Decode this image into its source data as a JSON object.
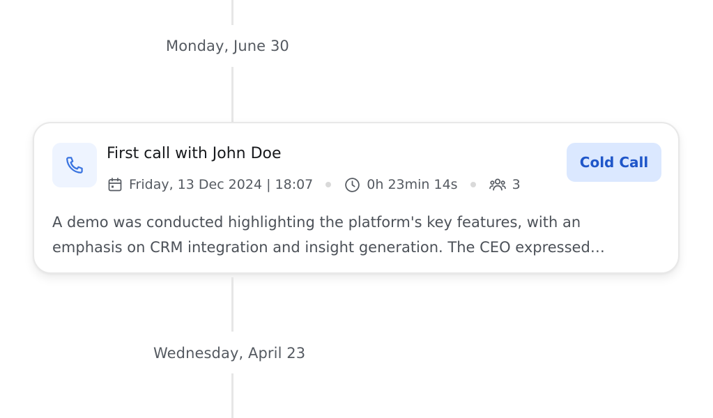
{
  "timeline": {
    "groups": [
      {
        "date_label": "Monday, June 30"
      },
      {
        "date_label": "Wednesday, April 23"
      }
    ]
  },
  "activity": {
    "icon": "phone-icon",
    "title": "First call with John Doe",
    "date_time": "Friday, 13 Dec 2024 | 18:07",
    "duration": "0h 23min 14s",
    "participants": "3",
    "tag_label": "Cold Call",
    "description": "A demo was conducted highlighting the platform's key features, with an emphasis on CRM integration and insight generation. The CEO expressed concerns about pricing and implementation timeline before committing to a pilot.",
    "colors": {
      "accent": "#1f56c9",
      "tag_bg": "#dbe8ff",
      "icon_bg": "#eef4ff"
    }
  }
}
